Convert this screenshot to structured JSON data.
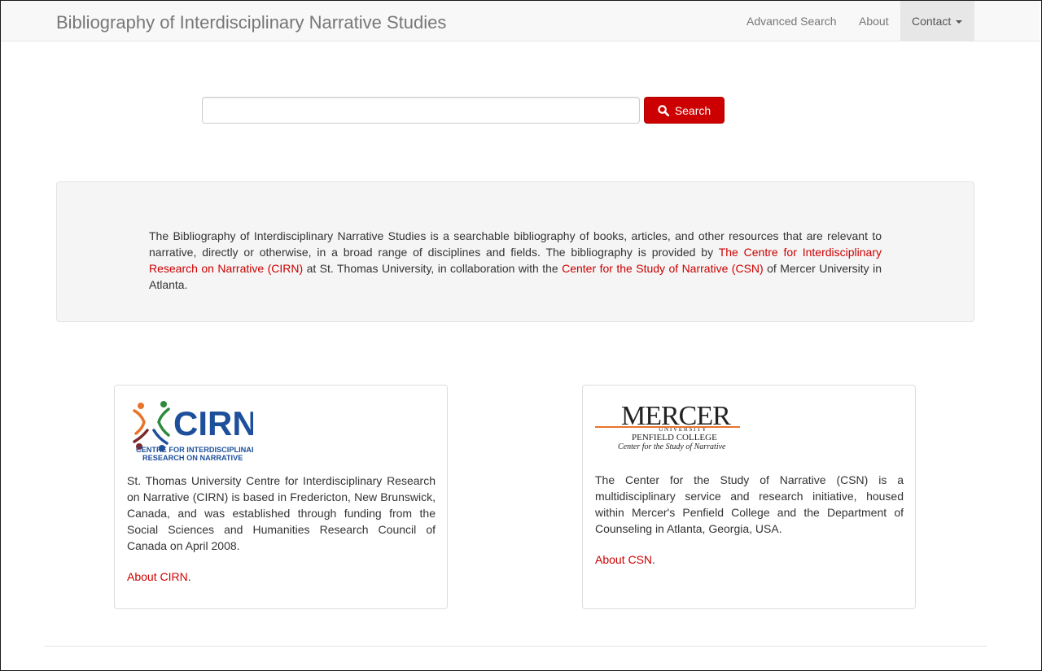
{
  "navbar": {
    "brand": "Bibliography of Interdisciplinary Narrative Studies",
    "items": [
      {
        "label": "Advanced Search"
      },
      {
        "label": "About"
      },
      {
        "label": "Contact"
      }
    ]
  },
  "search": {
    "value": "",
    "placeholder": "",
    "button_label": "Search",
    "button_icon": "search-icon",
    "button_color": "#cc0000"
  },
  "intro": {
    "text_1": "The Bibliography of Interdisciplinary Narrative Studies is a searchable bibliography of books, articles, and other resources that are relevant to narrative, directly or otherwise, in a broad range of disciplines and fields. The bibliography is provided by ",
    "link_1": "The Centre for Interdisciplinary Research on Narrative (CIRN)",
    "text_2": " at St. Thomas University, in collaboration with the ",
    "link_2": "Center for the Study of Narrative (CSN)",
    "text_3": " of Mercer University in Atlanta."
  },
  "cirn": {
    "logo": {
      "title": "CIRN",
      "line_1": "CENTRE FOR INTERDISCIPLINARY",
      "line_2": "RESEARCH ON NARRATIVE"
    },
    "description": "St. Thomas University Centre for Interdisciplinary Research on Narrative (CIRN) is based in Fredericton, New Brunswick, Canada, and was established through funding from the Social Sciences and Humanities Research Council of Canada on April 2008.",
    "link": "About CIRN",
    "link_suffix": "."
  },
  "csn": {
    "logo": {
      "title": "MERCER",
      "subtitle": "UNIVERSITY",
      "line_1": "PENFIELD COLLEGE",
      "line_2": "Center for the Study of Narrative"
    },
    "description": "The Center for the Study of Narrative (CSN) is a multidisciplinary service and research initiative, housed within Mercer's Penfield College and the Department of Counseling in Atlanta, Georgia, USA.",
    "link": "About CSN",
    "link_suffix": "."
  },
  "colors": {
    "accent": "#cc0000",
    "navbar_bg": "#f8f8f8",
    "well_bg": "#f5f5f5",
    "cirn_blue": "#1d4f9a",
    "mercer_orange": "#e8742a"
  }
}
